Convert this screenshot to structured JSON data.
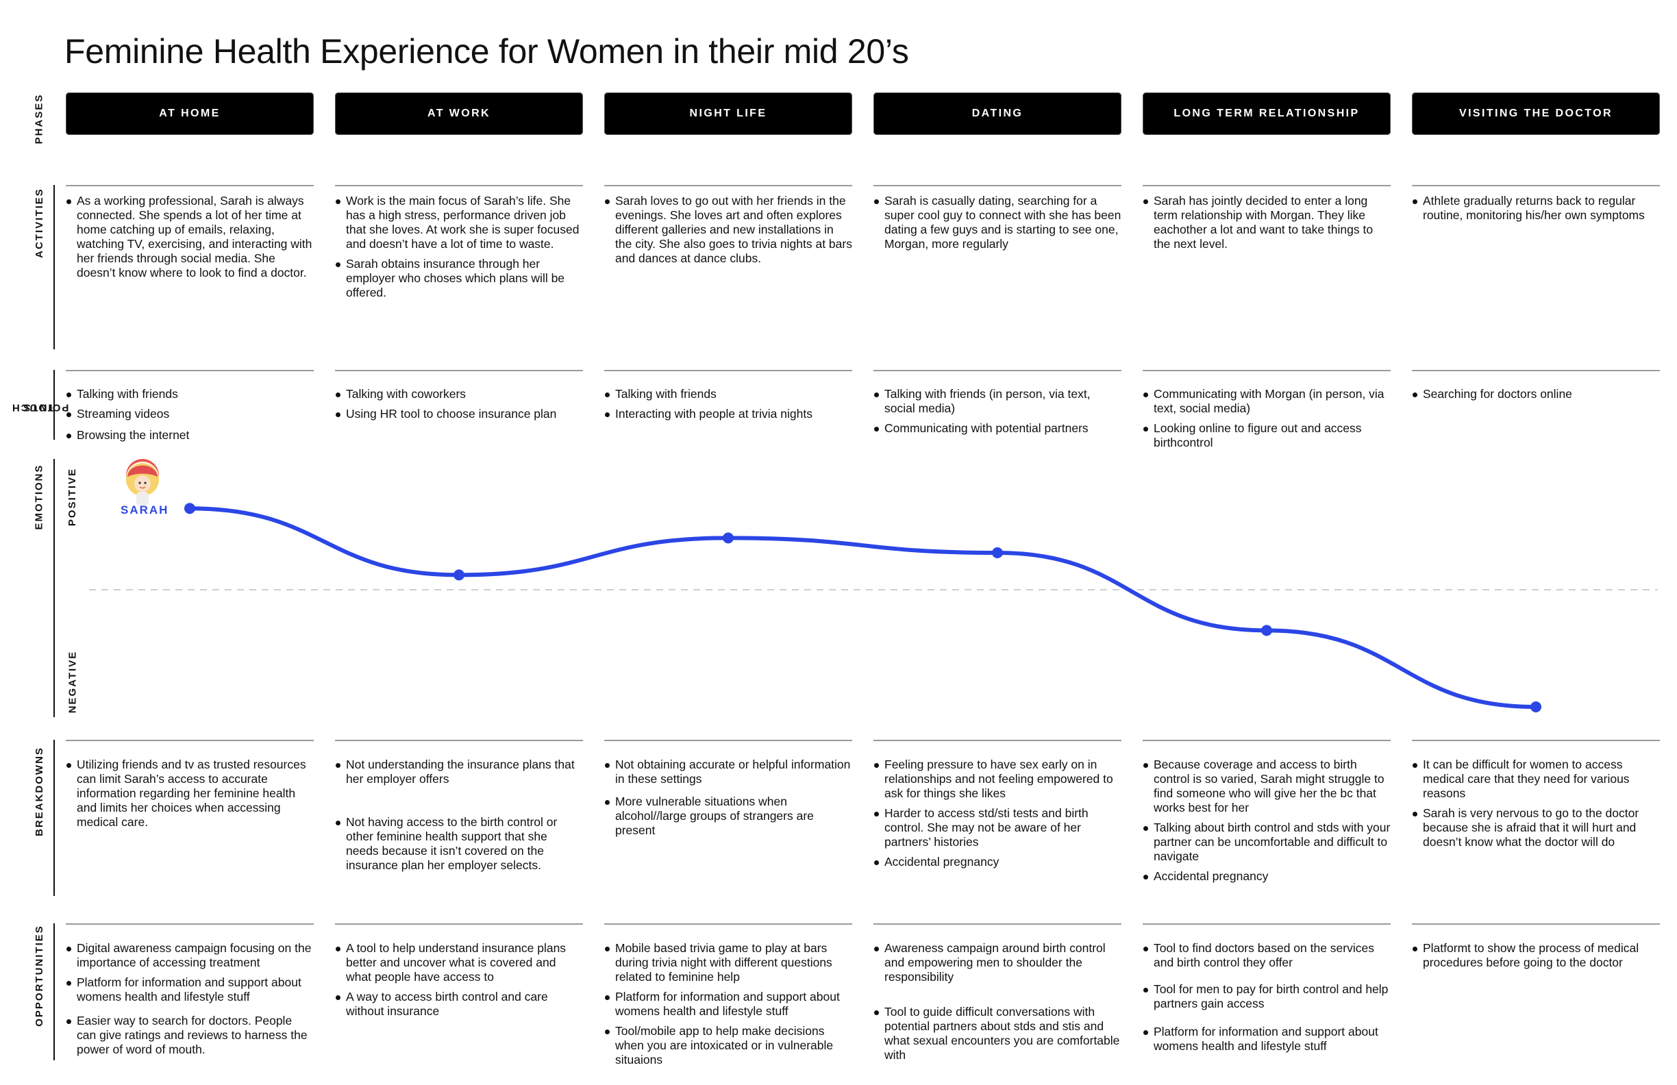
{
  "title": "Feminine Health Experience for Women in their mid 20’s",
  "row_labels": {
    "phases": "PHASES",
    "activities": "ACTIVITIES",
    "touch_points_line1": "TOUCH",
    "touch_points_line2": "POINTS",
    "emotions": "EMOTIONS",
    "breakdowns": "BREAKDOWNS",
    "opportunities": "OPPORTUNITIES"
  },
  "emotion_axis": {
    "positive": "POSITIVE",
    "negative": "NEGATIVE"
  },
  "persona": {
    "name": "SARAH"
  },
  "colors": {
    "curve": "#2b46e5",
    "phase_bg": "#000000"
  },
  "phases": [
    {
      "name": "AT HOME",
      "emotion": 0.66,
      "activities": [
        "As a working professional, Sarah is always connected. She spends a lot of her time at home catching up of emails, relaxing, watching TV, exercising, and interacting with her friends through social media. She doesn’t know where to look to find a doctor."
      ],
      "touch_points": [
        "Talking with friends",
        "Streaming videos",
        "Browsing the internet"
      ],
      "breakdowns": [
        "Utilizing friends and tv as trusted resources can limit Sarah’s access to accurate information regarding her feminine health and limits her choices when accessing medical care."
      ],
      "opportunities": [
        "Digital awareness campaign focusing on the importance of accessing treatment",
        "Platform for information and support about womens health and lifestyle stuff",
        "Easier way to search for doctors. People can give ratings and reviews to harness the power of word of mouth."
      ]
    },
    {
      "name": "AT WORK",
      "emotion": 0.12,
      "activities": [
        "Work is the main focus of Sarah’s life. She has a high stress, performance driven job that she loves. At work she is super focused and doesn’t have a lot of time to waste.",
        "Sarah obtains insurance through her employer who choses which plans will be offered."
      ],
      "touch_points": [
        "Talking with coworkers",
        "Using HR tool to choose insurance plan"
      ],
      "breakdowns": [
        "Not understanding the insurance plans that her employer offers",
        "Not having access to the birth control or other feminine health support that she needs because it isn’t covered on the insurance plan her employer selects."
      ],
      "opportunities": [
        "A tool to help understand insurance plans better and uncover what is covered and what people have access to",
        "A way to access birth control and care without insurance"
      ]
    },
    {
      "name": "NIGHT LIFE",
      "emotion": 0.42,
      "activities": [
        "Sarah loves to go out with her friends in the evenings. She loves art and often explores different galleries and new installations in the city. She also goes to trivia nights at  bars and dances at dance clubs."
      ],
      "touch_points": [
        "Talking with friends",
        "Interacting with people at trivia nights"
      ],
      "breakdowns": [
        "Not obtaining accurate or helpful information in these settings",
        "More vulnerable situations when alcohol//large groups of strangers are present"
      ],
      "opportunities": [
        "Mobile based trivia game to play at bars during trivia night with different questions related to feminine help",
        "Platform for information and support about womens health and lifestyle stuff",
        "Tool/mobile app to help make decisions when you are intoxicated or in vulnerable situaions"
      ]
    },
    {
      "name": "DATING",
      "emotion": 0.3,
      "activities": [
        "Sarah is casually dating, searching for a super cool guy to connect with she has been dating a few guys and is starting to see one, Morgan, more regularly"
      ],
      "touch_points": [
        "Talking with friends (in person, via text, social media)",
        "Communicating with potential partners"
      ],
      "breakdowns": [
        "Feeling pressure to have sex early on in relationships and not feeling empowered to ask for things she likes",
        "Harder to access std/sti tests and birth control. She may not be aware of her partners’ histories",
        "Accidental pregnancy"
      ],
      "opportunities": [
        "Awareness campaign around birth control and empowering men to shoulder the responsibility",
        "Tool to guide difficult conversations with potential partners about stds and stis and what sexual encounters you are comfortable with"
      ]
    },
    {
      "name": "LONG TERM RELATIONSHIP",
      "emotion": -0.33,
      "activities": [
        "Sarah has jointly decided to enter a long term relationship with Morgan. They like eachother a lot and want to take things to the next level."
      ],
      "touch_points": [
        "Communicating with Morgan (in person, via text, social media)",
        "Looking online to figure out and access birthcontrol"
      ],
      "breakdowns": [
        "Because coverage and access to birth control is so varied, Sarah might struggle to find someone who will give her the bc that works best for her",
        "Talking about birth control and stds with your partner can be uncomfortable and difficult to navigate",
        "Accidental pregnancy"
      ],
      "opportunities": [
        "Tool to find doctors based on the services and birth control they offer",
        "Tool for men to pay for birth control and help partners gain access",
        "Platform for information and support about womens health and lifestyle stuff"
      ]
    },
    {
      "name": "VISITING THE DOCTOR",
      "emotion": -0.95,
      "activities": [
        "Athlete gradually returns back to regular routine, monitoring his/her own symptoms"
      ],
      "touch_points": [
        "Searching for doctors online"
      ],
      "breakdowns": [
        "It can be difficult for women to access medical care that they  need for various reasons",
        "Sarah is very nervous to go to the doctor because she is afraid that it will hurt and doesn’t know what the doctor will do"
      ],
      "opportunities": [
        "Platformt to show the process of medical procedures before going to the doctor"
      ]
    }
  ]
}
